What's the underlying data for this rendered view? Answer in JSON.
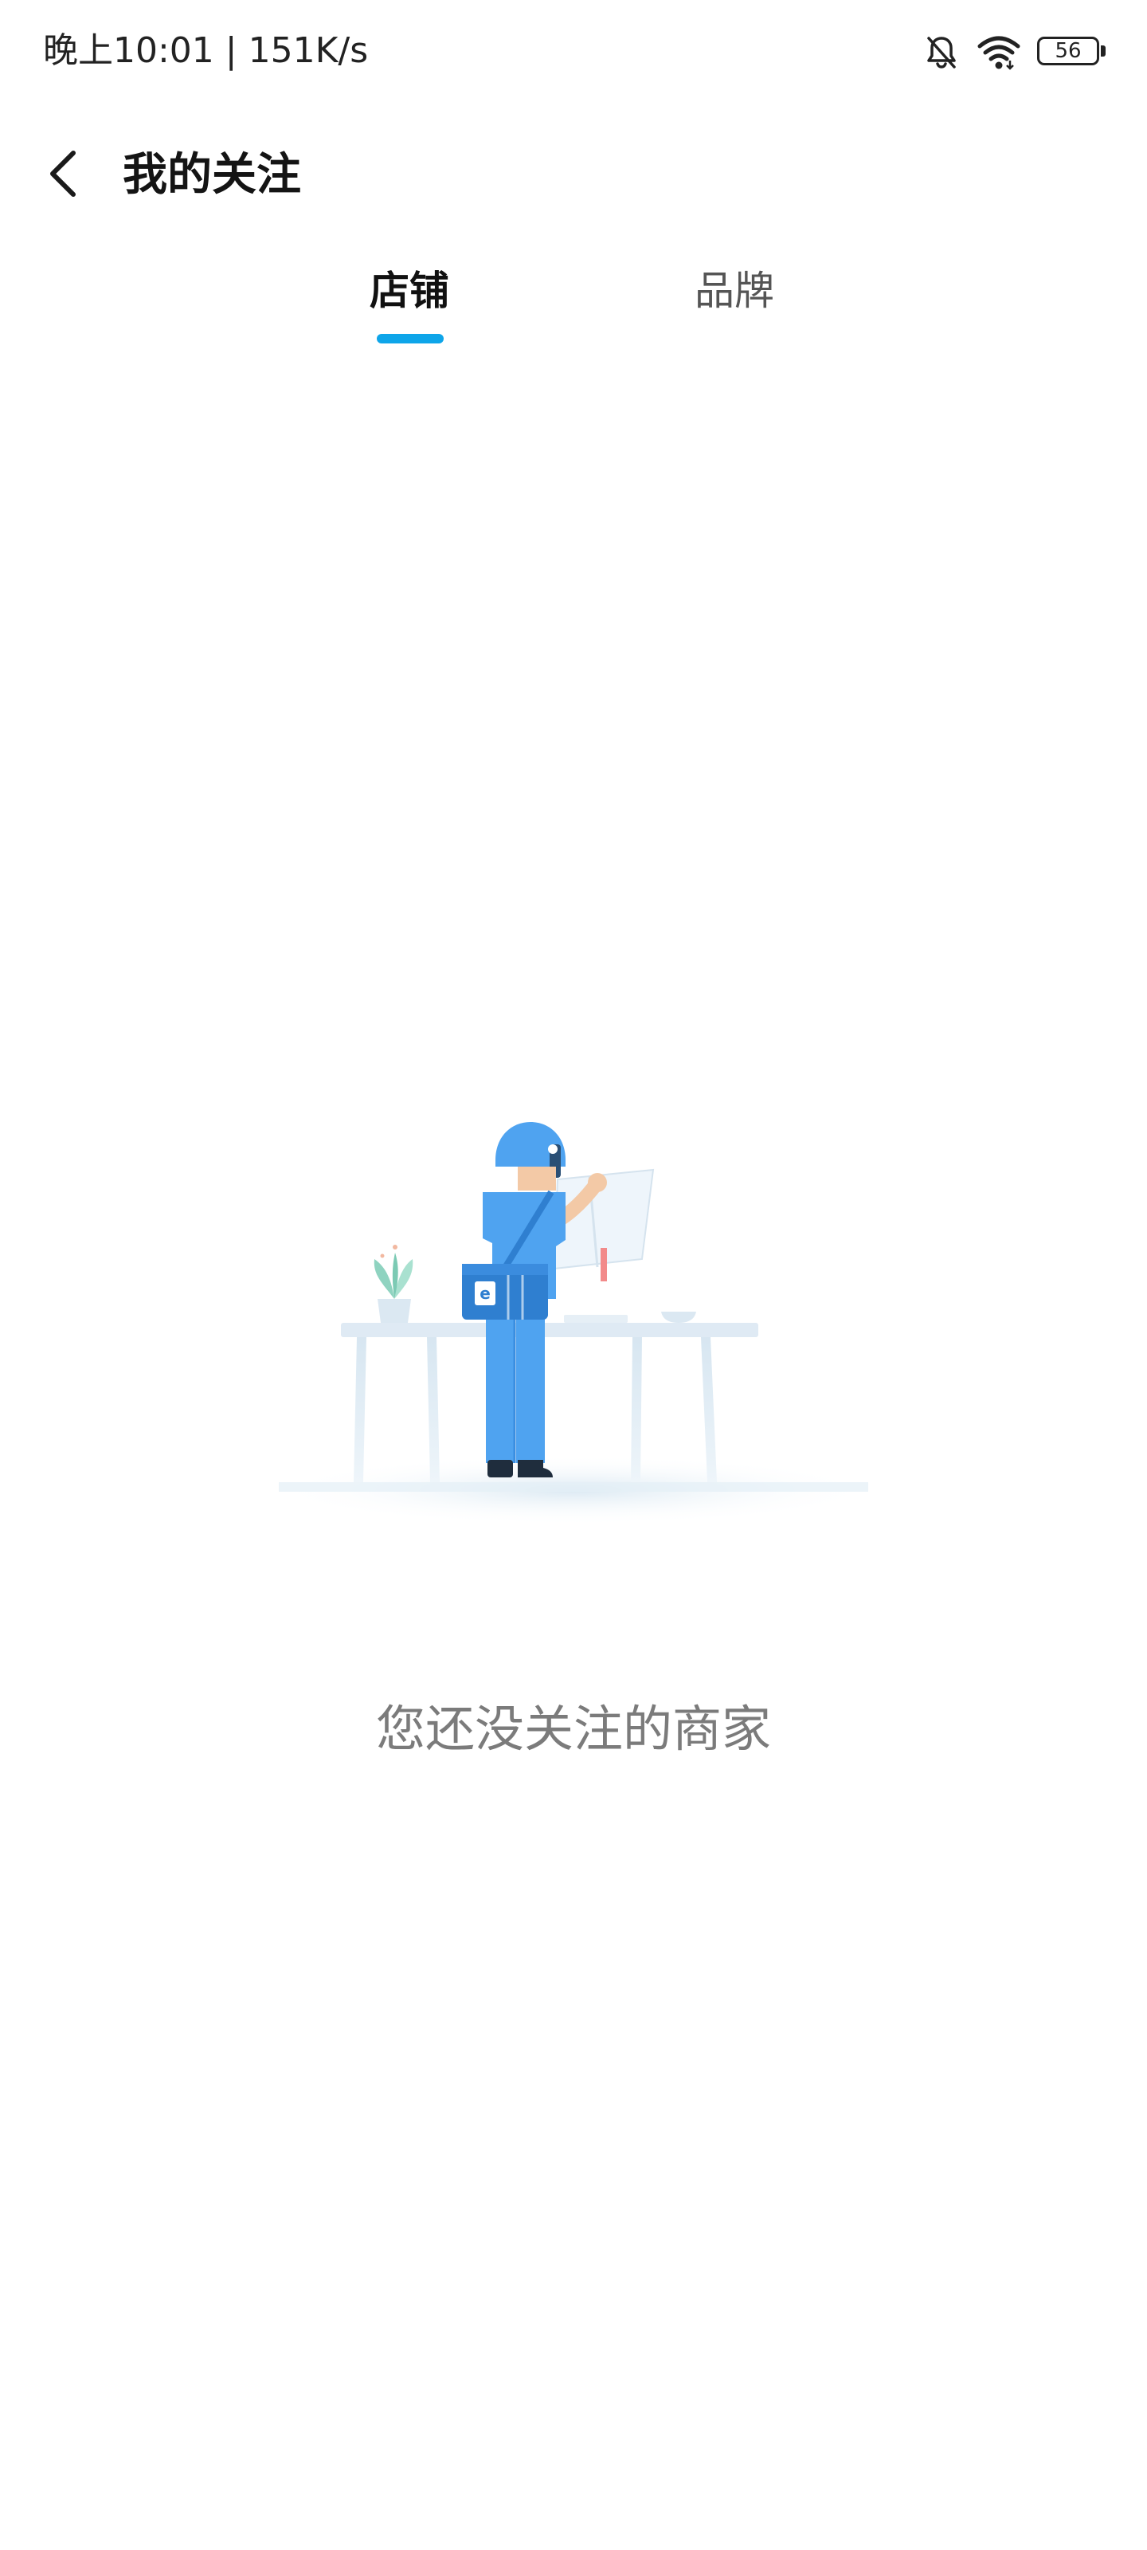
{
  "status_bar": {
    "text": "晚上10:01 | 151K/s",
    "battery": "56",
    "icons": [
      "bell-off-icon",
      "wifi-icon",
      "battery-icon"
    ]
  },
  "header": {
    "title": "我的关注",
    "back_icon": "chevron-left-icon"
  },
  "tabs": {
    "items": [
      {
        "label": "店铺",
        "active": true
      },
      {
        "label": "品牌",
        "active": false
      }
    ],
    "indicator_color": "#0ea5e9"
  },
  "empty_state": {
    "message": "您还没关注的商家",
    "illustration": "courier-reading-book-illustration"
  },
  "colors": {
    "accent": "#0ea5e9",
    "courier_blue": "#4fa3f0",
    "text_muted": "#7b7b7b"
  }
}
